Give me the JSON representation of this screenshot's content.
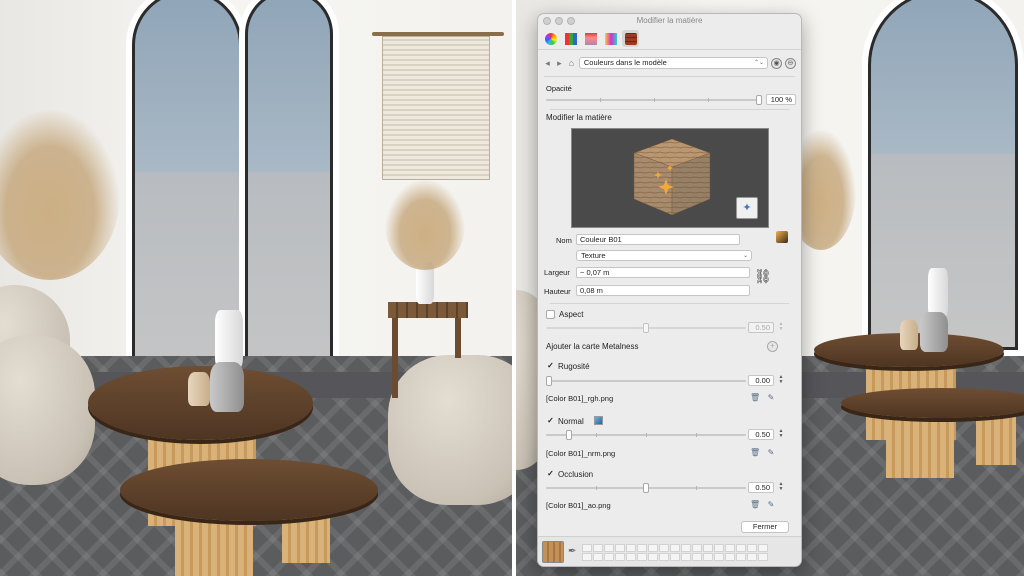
{
  "window": {
    "title": "Modifier la matière"
  },
  "tabs": [
    {
      "name": "color-wheel-tab",
      "icon": "color-wheel-icon"
    },
    {
      "name": "rgb-tab",
      "icon": "rgb-sliders-icon"
    },
    {
      "name": "hls-tab",
      "icon": "hls-sliders-icon"
    },
    {
      "name": "hsb-tab",
      "icon": "hsb-sliders-icon"
    },
    {
      "name": "material-tab",
      "icon": "brick-material-icon"
    }
  ],
  "toolbar": {
    "back_icon": "◂",
    "forward_icon": "▸",
    "home_icon": "⌂",
    "collection": "Couleurs dans le modèle"
  },
  "opacity": {
    "label": "Opacité",
    "value": "100 %",
    "level": 1.0
  },
  "edit": {
    "heading": "Modifier la matière",
    "name_label": "Nom",
    "name_value": "Couleur B01",
    "type_value": "Texture",
    "width_label": "Largeur",
    "width_value": "~ 0,07 m",
    "height_label": "Hauteur",
    "height_value": "0,08 m"
  },
  "aspect": {
    "label": "Aspect",
    "value": "0.50",
    "checked": false
  },
  "metalness": {
    "label": "Ajouter la carte Metalness"
  },
  "roughness": {
    "label": "Rugosité",
    "value": "0.00",
    "file": "[Color B01]_rgh.png",
    "checked": true
  },
  "normal": {
    "label": "Normal",
    "value": "0.50",
    "file": "[Color B01]_nrm.png",
    "checked": true
  },
  "occlusion": {
    "label": "Occlusion",
    "value": "0.50",
    "file": "[Color B01]_ao.png",
    "checked": true
  },
  "buttons": {
    "close": "Fermer"
  },
  "colors": {
    "accent": "#4a78c0",
    "panel_bg": "#ececec",
    "wood": "#c29159"
  }
}
